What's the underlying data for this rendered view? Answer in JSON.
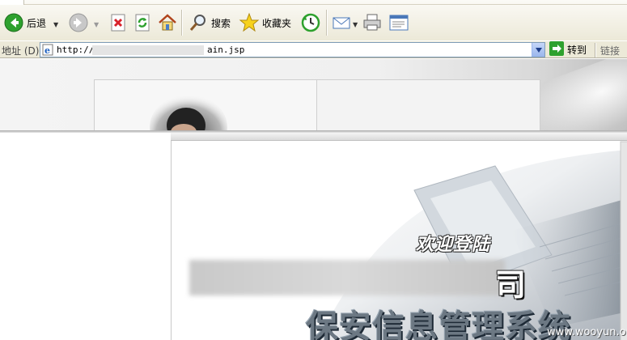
{
  "toolbar": {
    "back_label": "后退",
    "search_label": "搜索",
    "favorites_label": "收藏夹"
  },
  "address_bar": {
    "label": "地址 (D)",
    "url_prefix": "http://",
    "url_suffix": "ain.jsp",
    "go_label": "转到",
    "links_label": "链接"
  },
  "page": {
    "welcome_text": "欢迎登陆",
    "company_name_tail": "司",
    "system_name": "保安信息管理系统",
    "watermark": "www.wooyun.org"
  },
  "colors": {
    "accent_green": "#2ea12e",
    "window_chrome": "#ece9d8",
    "system_name": "#6c7883"
  }
}
